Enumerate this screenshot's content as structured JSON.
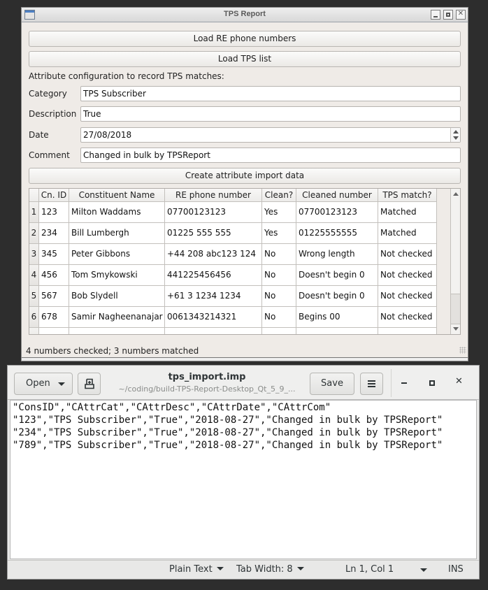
{
  "qt_window": {
    "title": "TPS Report",
    "buttons": {
      "load_re": "Load RE phone numbers",
      "load_tps": "Load TPS list",
      "create_attr": "Create attribute import data"
    },
    "config_heading": "Attribute configuration to record TPS matches:",
    "fields": {
      "category": {
        "label": "Category",
        "value": "TPS Subscriber"
      },
      "description": {
        "label": "Description",
        "value": "True"
      },
      "date": {
        "label": "Date",
        "value": "27/08/2018"
      },
      "comment": {
        "label": "Comment",
        "value": "Changed in bulk by TPSReport"
      }
    },
    "table": {
      "columns": [
        "Cn. ID",
        "Constituent Name",
        "RE phone number",
        "Clean?",
        "Cleaned number",
        "TPS match?"
      ],
      "rows": [
        {
          "n": "1",
          "cells": [
            "123",
            "Milton Waddams",
            "07700123123",
            "Yes",
            "07700123123",
            "Matched"
          ]
        },
        {
          "n": "2",
          "cells": [
            "234",
            "Bill Lumbergh",
            "01225 555 555",
            "Yes",
            "01225555555",
            "Matched"
          ]
        },
        {
          "n": "3",
          "cells": [
            "345",
            "Peter Gibbons",
            "+44 208 abc123 124",
            "No",
            "Wrong length",
            "Not checked"
          ]
        },
        {
          "n": "4",
          "cells": [
            "456",
            "Tom Smykowski",
            "441225456456",
            "No",
            "Doesn't begin 0",
            "Not checked"
          ]
        },
        {
          "n": "5",
          "cells": [
            "567",
            "Bob Slydell",
            "+61 3 1234 1234",
            "No",
            "Doesn't begin 0",
            "Not checked"
          ]
        },
        {
          "n": "6",
          "cells": [
            "678",
            "Samir Nagheenanajar",
            "0061343214321",
            "No",
            "Begins 00",
            "Not checked"
          ]
        }
      ]
    },
    "status": "4 numbers checked; 3 numbers matched"
  },
  "gedit": {
    "open_label": "Open",
    "save_label": "Save",
    "title": "tps_import.imp",
    "subtitle": "~/coding/build-TPS-Report-Desktop_Qt_5_9_...",
    "lines": [
      "\"ConsID\",\"CAttrCat\",\"CAttrDesc\",\"CAttrDate\",\"CAttrCom\"",
      "\"123\",\"TPS Subscriber\",\"True\",\"2018-08-27\",\"Changed in bulk by TPSReport\"",
      "\"234\",\"TPS Subscriber\",\"True\",\"2018-08-27\",\"Changed in bulk by TPSReport\"",
      "\"789\",\"TPS Subscriber\",\"True\",\"2018-08-27\",\"Changed in bulk by TPSReport\""
    ],
    "status": {
      "language": "Plain Text",
      "tab_width": "Tab Width: 8",
      "position": "Ln 1, Col 1",
      "mode": "INS"
    }
  }
}
